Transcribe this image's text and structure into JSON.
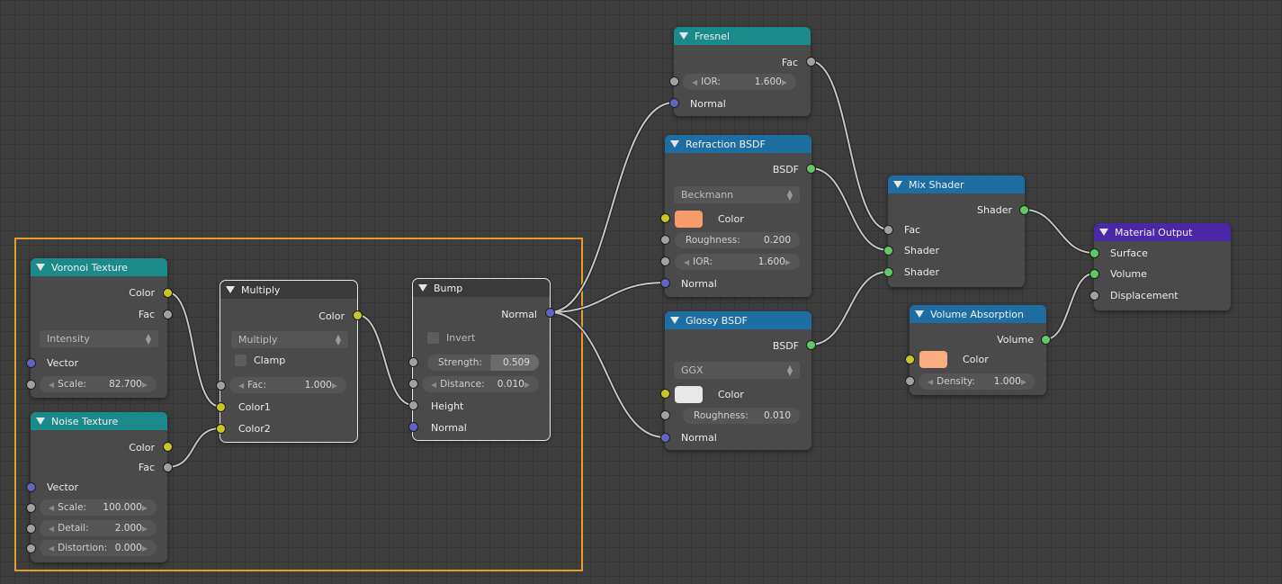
{
  "colors": {
    "header_texture": "#1b8a8a",
    "header_converter": "#3a3a3a",
    "header_shader": "#1e6ea3",
    "header_output": "#4a28a8",
    "frame": "#e89a2c",
    "socket_color": "#c7c729",
    "socket_float": "#a1a1a1",
    "socket_vector": "#6363c7",
    "socket_shader": "#63c763",
    "refraction_color": "#f79b6a",
    "glossy_color": "#e8e8e8",
    "absorption_color": "#f9ad80"
  },
  "nodes": {
    "fresnel": {
      "title": "Fresnel",
      "out_fac": "Fac",
      "ior_label": "IOR:",
      "ior_value": "1.600",
      "in_normal": "Normal"
    },
    "refraction": {
      "title": "Refraction BSDF",
      "out_bsdf": "BSDF",
      "distribution": "Beckmann",
      "in_color": "Color",
      "rough_label": "Roughness:",
      "rough_value": "0.200",
      "ior_label": "IOR:",
      "ior_value": "1.600",
      "in_normal": "Normal"
    },
    "glossy": {
      "title": "Glossy BSDF",
      "out_bsdf": "BSDF",
      "distribution": "GGX",
      "in_color": "Color",
      "rough_label": "Roughness:",
      "rough_value": "0.010",
      "in_normal": "Normal"
    },
    "mix": {
      "title": "Mix Shader",
      "out_shader": "Shader",
      "in_fac": "Fac",
      "in_shader1": "Shader",
      "in_shader2": "Shader"
    },
    "output": {
      "title": "Material Output",
      "in_surface": "Surface",
      "in_volume": "Volume",
      "in_displacement": "Displacement"
    },
    "absorption": {
      "title": "Volume Absorption",
      "out_volume": "Volume",
      "in_color": "Color",
      "density_label": "Density:",
      "density_value": "1.000"
    },
    "voronoi": {
      "title": "Voronoi Texture",
      "out_color": "Color",
      "out_fac": "Fac",
      "coloring": "Intensity",
      "in_vector": "Vector",
      "scale_label": "Scale:",
      "scale_value": "82.700"
    },
    "noise": {
      "title": "Noise Texture",
      "out_color": "Color",
      "out_fac": "Fac",
      "in_vector": "Vector",
      "scale_label": "Scale:",
      "scale_value": "100.000",
      "detail_label": "Detail:",
      "detail_value": "2.000",
      "distortion_label": "Distortion:",
      "distortion_value": "0.000"
    },
    "multiply": {
      "title": "Multiply",
      "out_color": "Color",
      "blend": "Multiply",
      "clamp": "Clamp",
      "fac_label": "Fac:",
      "fac_value": "1.000",
      "in_color1": "Color1",
      "in_color2": "Color2"
    },
    "bump": {
      "title": "Bump",
      "out_normal": "Normal",
      "invert": "Invert",
      "strength_label": "Strength:",
      "strength_value": "0.509",
      "distance_label": "Distance:",
      "distance_value": "0.010",
      "in_height": "Height",
      "in_normal": "Normal"
    }
  }
}
